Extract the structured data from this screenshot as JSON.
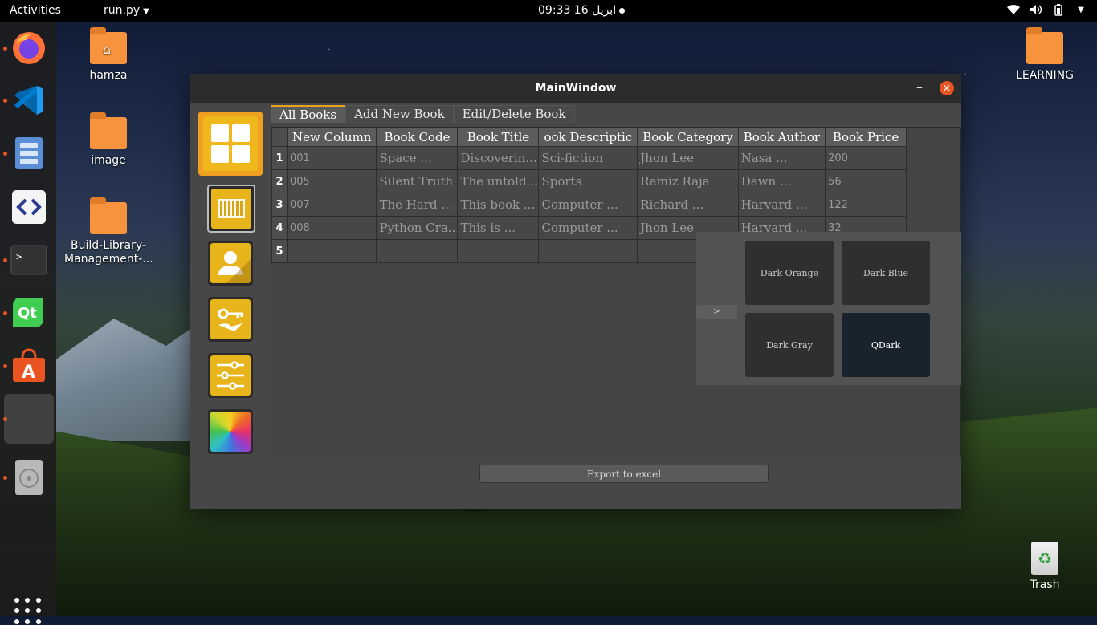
{
  "topbar": {
    "activities": "Activities",
    "app_name": "run.py",
    "clock": "09:33  ابریل 16"
  },
  "dock": {
    "items": [
      "firefox-icon",
      "vscode-icon",
      "files-icon",
      "code-editor-icon",
      "terminal-icon",
      "qt-creator-icon",
      "software-center-icon",
      "running-app-icon",
      "disk-icon"
    ],
    "show_apps": "show-applications-icon"
  },
  "desktop": {
    "icons": [
      {
        "label": "hamza"
      },
      {
        "label": "image"
      },
      {
        "label": "Build-Library-Management-..."
      },
      {
        "label": "LEARNING"
      }
    ],
    "trash": "Trash"
  },
  "window": {
    "title": "MainWindow",
    "tabs": [
      "All Books",
      "Add New Book",
      "Edit/Delete Book"
    ],
    "table": {
      "columns": [
        "New Column",
        "Book Code",
        "Book Title",
        "ook Descriptic",
        "Book Category",
        "Book Author",
        "Book Price"
      ],
      "rows": [
        {
          "num": "1",
          "cells": [
            "001",
            "Space ...",
            "Discoverin...",
            "Sci-fiction",
            "Jhon Lee",
            "Nasa ...",
            "200"
          ]
        },
        {
          "num": "2",
          "cells": [
            "005",
            "Silent Truth",
            "The untold...",
            "Sports",
            "Ramiz Raja",
            "Dawn ...",
            "56"
          ]
        },
        {
          "num": "3",
          "cells": [
            "007",
            "The Hard ...",
            "This book ...",
            "Computer ...",
            "Richard ...",
            "Harvard ...",
            "122"
          ]
        },
        {
          "num": "4",
          "cells": [
            "008",
            "Python Cra...",
            "This is ...",
            "Computer ...",
            "Jhon Lee",
            "Harvard ...",
            "32"
          ]
        },
        {
          "num": "5",
          "cells": [
            "",
            "",
            "",
            "",
            "",
            "",
            ""
          ]
        }
      ]
    },
    "themes": {
      "toggle": ">",
      "options": [
        "Dark Orange",
        "Dark Blue",
        "Dark Gray",
        "QDark"
      ]
    },
    "export_label": "Export to excel"
  }
}
